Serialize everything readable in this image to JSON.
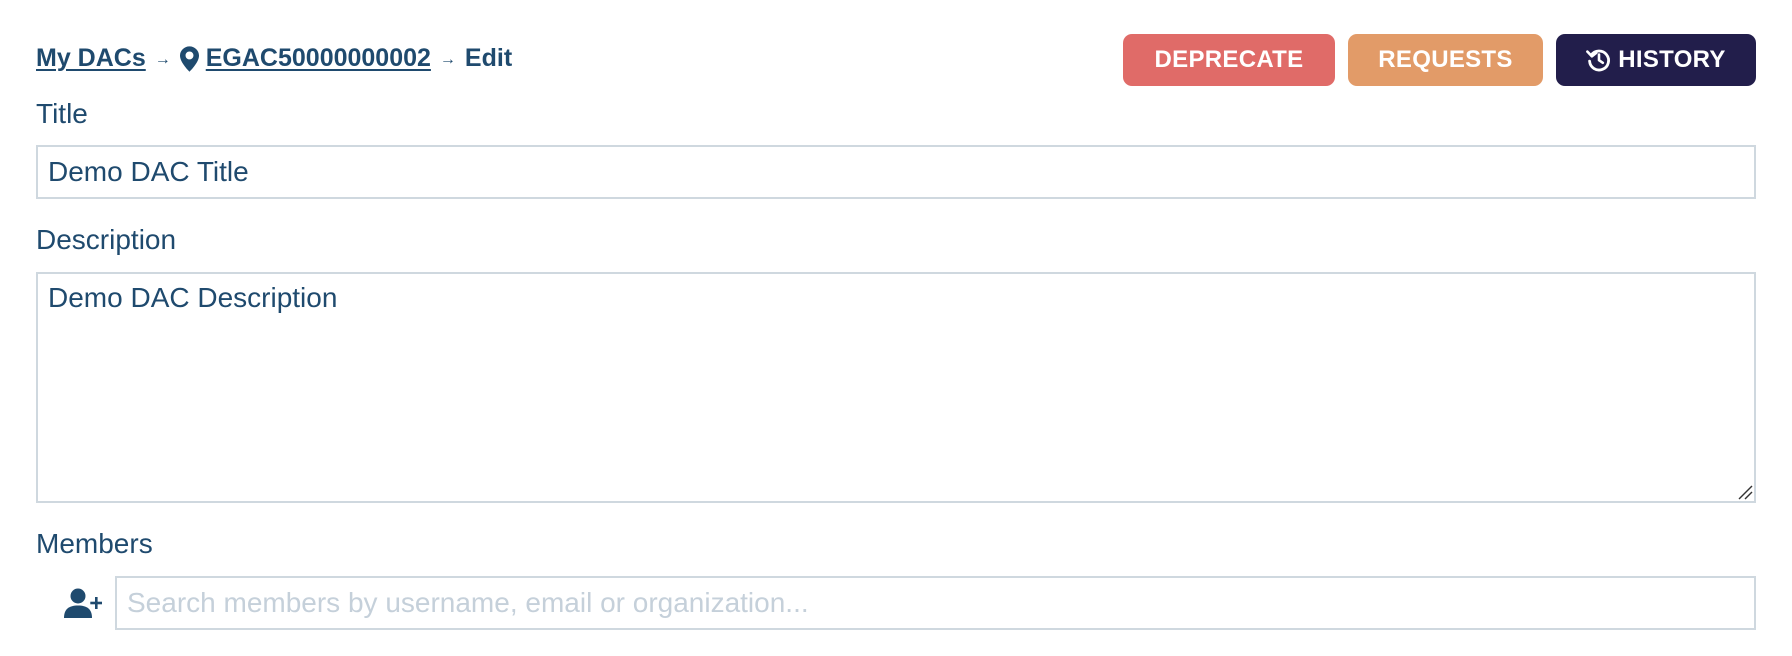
{
  "breadcrumb": {
    "root_label": "My DACs",
    "dac_id": "EGAC50000000002",
    "current": "Edit",
    "separator": "→"
  },
  "actions": {
    "deprecate_label": "DEPRECATE",
    "requests_label": "REQUESTS",
    "history_label": "HISTORY"
  },
  "form": {
    "title_label": "Title",
    "title_value": "Demo DAC Title",
    "description_label": "Description",
    "description_value": "Demo DAC Description",
    "members_label": "Members",
    "members_placeholder": "Search members by username, email or organization..."
  },
  "icons": {
    "pin": "map-marker-icon",
    "history": "history-icon",
    "add_user": "user-plus-icon"
  },
  "colors": {
    "text": "#1f4a6e",
    "deprecate": "#e06b68",
    "requests": "#e29b68",
    "history": "#221e4b",
    "border": "#cfd8df",
    "placeholder": "#c5d0da"
  }
}
